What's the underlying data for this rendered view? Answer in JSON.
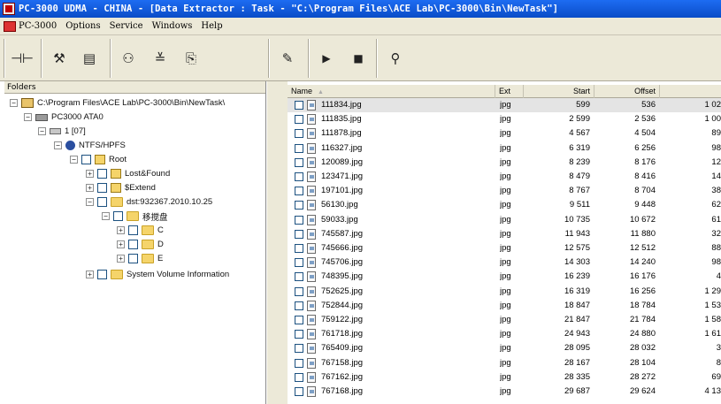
{
  "window": {
    "title": "PC-3000 UDMA - CHINA - [Data Extractor : Task - \"C:\\Program Files\\ACE Lab\\PC-3000\\Bin\\NewTask\"]"
  },
  "menu": [
    "PC-3000",
    "Options",
    "Service",
    "Windows",
    "Help"
  ],
  "toolbar": {
    "buttons": [
      "connect-icon",
      "tools-icon",
      "script-icon",
      "binoculars-icon",
      "stack-icon",
      "export-icon",
      "task-icon",
      "play-icon",
      "stop-icon",
      "walk-icon"
    ]
  },
  "folders": {
    "header": "Folders",
    "nodes": [
      {
        "label": "C:\\Program Files\\ACE Lab\\PC-3000\\Bin\\NewTask\\",
        "icon": "pc-icon"
      },
      {
        "label": "PC3000 ATA0",
        "icon": "drive-icon"
      },
      {
        "label": "1 [07]",
        "icon": "partition-icon"
      },
      {
        "label": "NTFS/HPFS",
        "icon": "filesystem-icon"
      },
      {
        "label": "Root",
        "icon": "root-icon",
        "glyph": "R"
      },
      {
        "label": "Lost&Found",
        "icon": "folder-icon",
        "glyph": "L"
      },
      {
        "label": "$Extend",
        "icon": "folder-icon",
        "glyph": "$"
      },
      {
        "label": "dst:932367.2010.10.25",
        "icon": "folder-icon"
      },
      {
        "label": "移搅盘",
        "icon": "folder-icon"
      },
      {
        "label": "C",
        "icon": "folder-icon"
      },
      {
        "label": "D",
        "icon": "folder-icon"
      },
      {
        "label": "E",
        "icon": "folder-icon"
      },
      {
        "label": "System Volume Information",
        "icon": "folder-icon"
      }
    ]
  },
  "files": {
    "columns": {
      "name": "Name",
      "ext": "Ext",
      "start": "Start",
      "offset": "Offset"
    },
    "rows": [
      {
        "name": "111834.jpg",
        "ext": "jpg",
        "start": "599",
        "offset": "536",
        "more": "1 02"
      },
      {
        "name": "111835.jpg",
        "ext": "jpg",
        "start": "2 599",
        "offset": "2 536",
        "more": "1 00"
      },
      {
        "name": "111878.jpg",
        "ext": "jpg",
        "start": "4 567",
        "offset": "4 504",
        "more": "89"
      },
      {
        "name": "116327.jpg",
        "ext": "jpg",
        "start": "6 319",
        "offset": "6 256",
        "more": "98"
      },
      {
        "name": "120089.jpg",
        "ext": "jpg",
        "start": "8 239",
        "offset": "8 176",
        "more": "12"
      },
      {
        "name": "123471.jpg",
        "ext": "jpg",
        "start": "8 479",
        "offset": "8 416",
        "more": "14"
      },
      {
        "name": "197101.jpg",
        "ext": "jpg",
        "start": "8 767",
        "offset": "8 704",
        "more": "38"
      },
      {
        "name": "56130.jpg",
        "ext": "jpg",
        "start": "9 511",
        "offset": "9 448",
        "more": "62"
      },
      {
        "name": "59033.jpg",
        "ext": "jpg",
        "start": "10 735",
        "offset": "10 672",
        "more": "61"
      },
      {
        "name": "745587.jpg",
        "ext": "jpg",
        "start": "11 943",
        "offset": "11 880",
        "more": "32"
      },
      {
        "name": "745666.jpg",
        "ext": "jpg",
        "start": "12 575",
        "offset": "12 512",
        "more": "88"
      },
      {
        "name": "745706.jpg",
        "ext": "jpg",
        "start": "14 303",
        "offset": "14 240",
        "more": "98"
      },
      {
        "name": "748395.jpg",
        "ext": "jpg",
        "start": "16 239",
        "offset": "16 176",
        "more": "4"
      },
      {
        "name": "752625.jpg",
        "ext": "jpg",
        "start": "16 319",
        "offset": "16 256",
        "more": "1 29"
      },
      {
        "name": "752844.jpg",
        "ext": "jpg",
        "start": "18 847",
        "offset": "18 784",
        "more": "1 53"
      },
      {
        "name": "759122.jpg",
        "ext": "jpg",
        "start": "21 847",
        "offset": "21 784",
        "more": "1 58"
      },
      {
        "name": "761718.jpg",
        "ext": "jpg",
        "start": "24 943",
        "offset": "24 880",
        "more": "1 61"
      },
      {
        "name": "765409.jpg",
        "ext": "jpg",
        "start": "28 095",
        "offset": "28 032",
        "more": "3"
      },
      {
        "name": "767158.jpg",
        "ext": "jpg",
        "start": "28 167",
        "offset": "28 104",
        "more": "8"
      },
      {
        "name": "767162.jpg",
        "ext": "jpg",
        "start": "28 335",
        "offset": "28 272",
        "more": "69"
      },
      {
        "name": "767168.jpg",
        "ext": "jpg",
        "start": "29 687",
        "offset": "29 624",
        "more": "4 13"
      }
    ]
  }
}
